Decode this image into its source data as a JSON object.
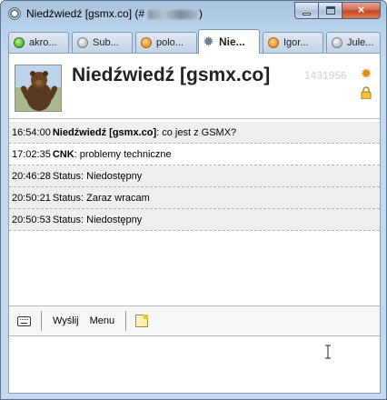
{
  "window": {
    "title": "Niedźwiedź [gsmx.co] (#",
    "title_suffix": ")",
    "buttons": {
      "minimize": "minimize",
      "maximize": "maximize",
      "close": "×"
    }
  },
  "tabs": [
    {
      "label": "akro...",
      "icon": "online-status-icon",
      "active": false
    },
    {
      "label": "Sub...",
      "icon": "offline-status-icon",
      "active": false
    },
    {
      "label": "polo...",
      "icon": "away-status-icon",
      "active": false
    },
    {
      "label": "Nie...",
      "icon": "gear-icon",
      "active": true
    },
    {
      "label": "Igor...",
      "icon": "away-status-icon",
      "active": false
    },
    {
      "label": "Jule...",
      "icon": "offline-status-icon",
      "active": false
    }
  ],
  "contact": {
    "name": "Niedźwiedź [gsmx.co]",
    "number": "1431956",
    "status_icon": "sun-icon",
    "secure_icon": "lock-icon"
  },
  "messages": [
    {
      "time": "16:54:00",
      "author": "Niedźwiedź [gsmx.co]",
      "text": ": co jest z GSMX?"
    },
    {
      "time": "17:02:35",
      "author": "CNK",
      "text": ": problemy techniczne"
    },
    {
      "time": "20:46:28",
      "author": "",
      "text": "Status: Niedostępny"
    },
    {
      "time": "20:50:21",
      "author": "",
      "text": "Status: Zaraz wracam"
    },
    {
      "time": "20:50:53",
      "author": "",
      "text": "Status: Niedostępny"
    }
  ],
  "toolbar": {
    "send_label": "Wyślij",
    "menu_label": "Menu"
  },
  "input": {
    "value": ""
  }
}
